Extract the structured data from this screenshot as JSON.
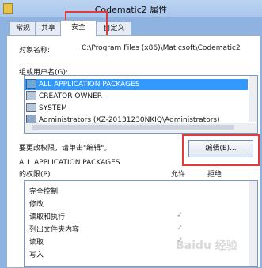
{
  "window": {
    "title": "Codematic2 属性"
  },
  "tabs": [
    {
      "label": "常规"
    },
    {
      "label": "共享"
    },
    {
      "label": "安全"
    },
    {
      "label": "自定义"
    }
  ],
  "security": {
    "object_name_label": "对象名称:",
    "object_name_value": "C:\\Program Files (x86)\\Maticsoft\\Codematic2",
    "group_label": "组或用户名(G):",
    "principals": [
      {
        "name": "ALL APPLICATION PACKAGES",
        "selected": true
      },
      {
        "name": "CREATOR OWNER",
        "selected": false
      },
      {
        "name": "SYSTEM",
        "selected": false
      },
      {
        "name": "Administrators (XZ-20131230NKIQ\\Administrators)",
        "selected": false
      }
    ],
    "change_hint": "要更改权限，请单击\"编辑\"。",
    "edit_button": "编辑(E)...",
    "perm_for_line1": "ALL APPLICATION PACKAGES",
    "perm_for_line2": "的权限(P)",
    "allow_header": "允许",
    "deny_header": "拒绝",
    "permissions": [
      {
        "name": "完全控制",
        "allow": ""
      },
      {
        "name": "修改",
        "allow": ""
      },
      {
        "name": "读取和执行",
        "allow": "✓"
      },
      {
        "name": "列出文件夹内容",
        "allow": "✓"
      },
      {
        "name": "读取",
        "allow": "✓"
      },
      {
        "name": "写入",
        "allow": ""
      }
    ]
  },
  "watermark": "Baidu 经验"
}
